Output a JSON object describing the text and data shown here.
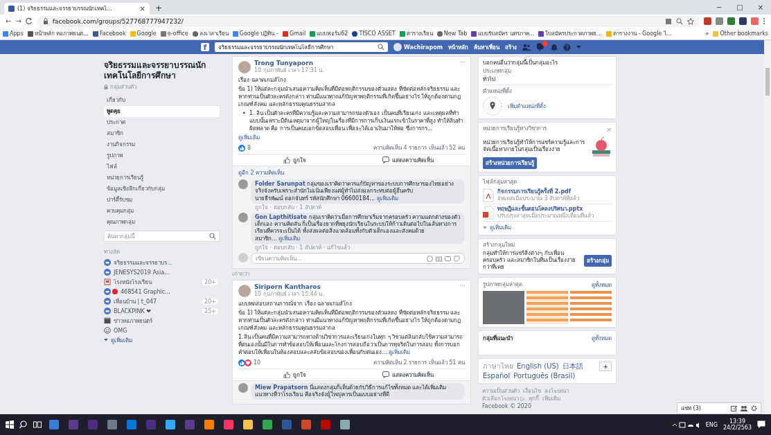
{
  "browser": {
    "tab": {
      "title": "(1) จริยธรรมและจรรยาบรรณนักเทคโ...",
      "close": "×",
      "selected": true
    },
    "new_tab": "+",
    "window_controls": [
      "−",
      "□",
      "×"
    ],
    "nav": [
      "←",
      "→"
    ],
    "url": "facebook.com/groups/527768777947232/",
    "bookmarks": [
      {
        "label": "Apps",
        "kind": "apps"
      },
      {
        "label": "หน้าหลัก หอภาพยนต...",
        "kind": "page"
      },
      {
        "label": "Facebook",
        "kind": "fb"
      },
      {
        "label": "Google",
        "kind": "google"
      },
      {
        "label": "e-office",
        "kind": "office"
      },
      {
        "label": "ลงเวลาเรียน",
        "kind": "globe"
      },
      {
        "label": "Google ปฏิทิน -",
        "kind": "cal"
      },
      {
        "label": "Gmail",
        "kind": "gmail"
      },
      {
        "label": "แบบฟอร์ม62",
        "kind": "sheet"
      },
      {
        "label": "TISCO ASSET",
        "kind": "tisco"
      },
      {
        "label": "ตารางเรียน",
        "kind": "sheet"
      },
      {
        "label": "New Tab",
        "kind": "globe"
      },
      {
        "label": "แบบรับสมัคร นทรภาค...",
        "kind": "form"
      },
      {
        "label": "ใบสมัครประกวดภาพย...",
        "kind": "form"
      },
      {
        "label": "ตารางงาน - Google ไ...",
        "kind": "drive"
      }
    ],
    "bookmarks_more": "»",
    "other_bookmarks": "Other bookmarks"
  },
  "fb_header": {
    "logo": "f",
    "search": "จริยธรรมและจรรยาบรรณนักเทคโนโลยีการศึกษา",
    "user": "Wachirapom",
    "links": [
      "หน้าหลัก",
      "ค้นหาเพื่อน",
      "สร้าง"
    ]
  },
  "sidebar": {
    "group_name": "จริยธรรมและจรรยาบรรณนักเทคโนโลยีการศึกษา",
    "privacy": "กลุ่มส่วนตัว",
    "items": [
      {
        "label": "เกี่ยวกับ",
        "selected": false
      },
      {
        "label": "พูดคุย",
        "selected": true
      },
      {
        "label": "ประกาศ",
        "selected": false
      },
      {
        "label": "สมาชิก",
        "selected": false
      },
      {
        "label": "งานกิจกรรม",
        "selected": false
      },
      {
        "label": "รูปภาพ",
        "selected": false
      },
      {
        "label": "ไฟล์",
        "selected": false
      },
      {
        "label": "หน่วยการเรียนรู้",
        "selected": false
      },
      {
        "label": "ข้อมูลเชิงลึกเกี่ยวกับกลุ่ม",
        "selected": false
      },
      {
        "label": "ปาร์ตี้รับชม",
        "selected": false
      },
      {
        "label": "ควบคุมกลุ่ม",
        "selected": false
      },
      {
        "label": "คุณภาพกลุ่ม",
        "selected": false
      }
    ],
    "search_placeholder": "ค้นหากลุ่มนี้",
    "shortcuts_heading": "ทางลัด",
    "shortcuts": [
      {
        "label": "จริยธรรมและจรรยาบร...",
        "kind": "group"
      },
      {
        "label": "JENESYS2019 Asia...",
        "kind": "group"
      },
      {
        "label": "โรงหนังโรงเรียน",
        "kind": "page",
        "badge": "20+"
      },
      {
        "label": "468541 Graphic...",
        "kind": "group-dot"
      },
      {
        "label": "เพื่อนบ้าน | t_047",
        "kind": "group",
        "badge": "20+"
      },
      {
        "label": "BLACKPINK ❤",
        "kind": "group",
        "badge": "25+"
      },
      {
        "label": "ข่าวหอภาพยนตร์",
        "kind": "film"
      },
      {
        "label": "OMG",
        "kind": "face"
      }
    ],
    "more": "ดูเพิ่มเติม"
  },
  "feed": {
    "older": "เก่ากว่า",
    "posts": [
      {
        "author": "Trong Tunyaporn",
        "time": "10 กุมภาพันธ์ เวลา 17:31 น.",
        "menu": "···",
        "body": [
          {
            "kind": "para",
            "text": "เรื่อง ฉลาดเกมส์โกง"
          },
          {
            "kind": "para",
            "text": "ข้อ 1) ให้แต่ละกลุ่มนำเสนอความคิดเห็นที่มีต่อพฤติกรรมของตัวแสดง ที่ขัดต่อหลักจริยธรรม และหากท่านเป็นตัวละครดังกล่าว ท่านมีแนวทางแก้ปัญหาพฤติกรรมที่เกิดขึ้นอย่างไร ให้ถูกต้องตามกฎเกณฑ์สังคม และหลักธรรมคุณธรรมสากล"
          },
          {
            "kind": "bullet",
            "marker": "•",
            "text": "1. ลิน เป็นตัวละครที่มีความรู้และความสามารถของตัวเอง เป็นคนที่เรียนเก่ง และเหตุผลที่ทำแบบนั้นเพราะมีต้นเหตุมาจากผู้ใหญ่ในเรื่องที่มีการการเก็บเงินแรกเข้าในราคาที่สูง ทำให้ลินทำผิดพลาด คือ การเป็นคนบอกข้อสอบเพื่อน เพื่อจะได้เอาเงินมาให้พ่อ ซึ่งการกร..."
          }
        ],
        "see_more": "ดูเพิ่มเติม",
        "see_more_inline": false,
        "reactions": [
          {
            "kind": "like"
          }
        ],
        "reaction_count": "8",
        "stats": "ความคิดเห็น 4 รายการ เห็นแล้ว 52 คน",
        "actions": [
          "ถูกใจ",
          "แสดงความคิดเห็น"
        ],
        "more_comments": "ดูอีก 2 ความคิดเห็น",
        "comments": [
          {
            "author": "Folder Sarunpat",
            "text": "กลุ่มของเราคิดว่าควรแก้ปัญหาของระบบการศึกษาของไทยอย่างจริงจังครับเพราะสำนักไม่เน้นเพียงแต่ผู้ทำไม่ส่งผลกระทบต่อผู้อื่นครับ",
            "extra": "นายธีรพัฒน์ ดอกจันทร์ รหัสนักศึกษา 06600184...",
            "see_more": "ดูเพิ่มเติม",
            "meta": "ถูกใจ · ตอบกลับ · 1 สัปดาห์"
          },
          {
            "author": "Gon Lapthitisate",
            "text": "กลุ่มเราคิดว่าเมื่อการศึกษาเริ่มจากครอบครัว ความแตกต่างของตัวเด็กเอง ความคิดสัน ก็เป็นเรื่องยากที่พยุงนักเรียนในระบบให้ก้าวเดินต่อไปในเส้นทางการเรียนที่ควรจะเป็นได้ ทั้งส่งผลต่อสิ่งแวดล้อมทั้งกับตัวเด็กเองและสังคมด้วย",
            "extra": "สมาชิก...",
            "see_more": "ดูเพิ่มเติม",
            "meta": "ถูกใจ · ตอบกลับ · 1 สัปดาห์ · แก้ไขแล้ว"
          }
        ],
        "comment_placeholder": "เขียนความคิดเห็น..."
      },
      {
        "author": "Siriporn Kantharos",
        "time": "10 กุมภาพันธ์ เวลา 15:44 น.",
        "menu": "···",
        "body": [
          {
            "kind": "para",
            "text": "แบบทดสอบสถานการณ์จาก เรื่อง ฉลาดเกมส์โกง"
          },
          {
            "kind": "para",
            "text": "ข้อ 1) ให้แต่ละกลุ่มนำเสนอความคิดเห็นที่มีต่อพฤติกรรมของตัวแสดง ที่ขัดต่อหลักจริยธรรม และหากท่านเป็นตัวละครดังกล่าว ท่านมีแนวทางแก้ปัญหาพฤติกรรมที่เกิดขึ้นอย่างไร ให้ถูกต้องตามกฎเกณฑ์สังคม และหลักธรรมคุณธรรมสากล"
          },
          {
            "kind": "para",
            "text": "1.ลิน เป็นคนที่มีความสามารถทางด้านวิชาการและเรียนเก่งในทุก ๆ วิชาแต่ลินกลับใช้ความสามารถที่ตนเองนั้นมีในการทำข้อสอบให้เพื่อนและโกงการสอบถือว่าเป็นการทุจริตในการสอบ ทั้งการบอกคำตอบให้เพื่อนในห้องสอบและสลับข้อสอบของเพื่อนกับตนเอง..."
          }
        ],
        "see_more": "ดูเพิ่มเติม",
        "see_more_inline": true,
        "reactions": [
          {
            "kind": "like"
          },
          {
            "kind": "love"
          }
        ],
        "reaction_count": "10",
        "stats": "ความคิดเห็น 2 รายการ เห็นแล้ว 51 คน",
        "actions": [
          "ถูกใจ",
          "แสดงความคิดเห็น"
        ],
        "comments": [
          {
            "author": "Miew Prapatsorn",
            "text": "นี่แสดงกลุ่มก็เห็นด้วยกับวิธีการแก้ไขทั้งหมด และได้เพิ่มเติมแนวทางที่ว่าโรงเรียน คือจริงจังผู้ใหญ่ควรเป็นแบบอย่างที่ดี"
          }
        ]
      }
    ]
  },
  "right": {
    "description_value": "บอกคนอื่นว่ากลุ่มนี้เป็นกลุ่มอะไร",
    "type_label": "ประเภทกลุ่ม",
    "type_value": "ทั่วไป",
    "location_label": "ตำแหน่งที่ตั้ง",
    "location_action": "เพิ่มตำแหน่งที่ตั้ง",
    "units": {
      "title": "หน่วยการเรียนรู้ทางวิชาการ",
      "close": "×",
      "text": "หน่วยการเรียนรู้ทำให้การแชร์ความรู้และการจัดเนื้อหาภายในกลุ่มเป็นเรื่องง่าย",
      "button": "สร้างหน่วยการเรียนรู้"
    },
    "files": {
      "title": "ไฟล์กลุ่มล่าสุด",
      "items": [
        {
          "kind": "pdf",
          "name": "กิจกรรมการเรียนรู้ครั้งที่ 2.pdf",
          "meta": "อัพเดตเมื่อประมาณ 3 สัปดาห์ที่แล้ว"
        },
        {
          "kind": "pptx",
          "name": "ทฤษฎีและขั้นตอนโคลงปริศนา.pptx",
          "meta": "ปรับปรุงล่าสุดเมื่อประมาณหนึ่งเดือนที่แล้ว"
        }
      ],
      "more": "ดูเพิ่มเติม"
    },
    "new_group": {
      "title": "สร้างกลุ่มใหม่",
      "text": "กลุ่มทำให้การแชร์สิ่งต่างๆ กับเพื่อน ครอบครัว และสมาชิกในทีมเป็นเรื่องง่ายกว่าที่เคย",
      "button": "สร้างกลุ่ม"
    },
    "photos": {
      "title": "รูปภาพกลุ่มล่าสุด",
      "see_all": "ดูทั้งหมด"
    },
    "suggested": {
      "title": "กลุ่มที่แนะนำ",
      "see_all": "ดูทั้งหมด"
    },
    "languages": [
      "ภาษาไทย",
      "English (US)",
      "日本語",
      "Español",
      "Português (Brasil)"
    ],
    "add_language": "+",
    "footer": [
      "ความเป็นส่วนตัว",
      "เงื่อนไข",
      "ลงโฆษณา",
      "ตัวเลือกโฆษณา ▷",
      "คุกกี้",
      "เพิ่มเติม"
    ],
    "copyright": "Facebook © 2020"
  },
  "chat": "แชท (3)",
  "taskbar": {
    "language": "ENG",
    "time": "13:39",
    "date": "24/2/2563"
  }
}
